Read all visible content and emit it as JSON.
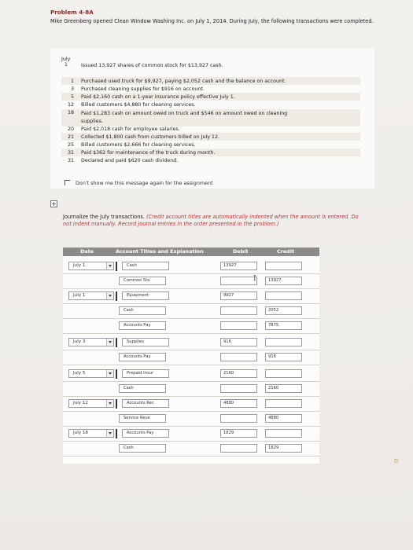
{
  "problem": {
    "title": "Problem 4-8A",
    "description": "Mike Greenberg opened Clean Window Washing Inc. on July 1, 2014. During July, the following transactions were completed."
  },
  "transactions": {
    "month_label": "July",
    "first_day": "1",
    "first_text": "Issued 13,927 shares of common stock for $13,927 cash.",
    "items": [
      {
        "day": "1",
        "text": "Purchased used truck for $9,927, paying $2,052 cash and the balance on account."
      },
      {
        "day": "3",
        "text": "Purchased cleaning supplies for $916 on account."
      },
      {
        "day": "5",
        "text": "Paid $2,160 cash on a 1-year insurance policy effective July 1."
      },
      {
        "day": "12",
        "text": "Billed customers $4,880 for cleaning services."
      },
      {
        "day": "18",
        "text": "Paid $1,283 cash on amount owed on truck and $546 on amount owed on cleaning"
      },
      {
        "day": "",
        "text": "supplies."
      },
      {
        "day": "20",
        "text": "Paid $2,018 cash for employee salaries."
      },
      {
        "day": "21",
        "text": "Collected $1,800 cash from customers billed on July 12."
      },
      {
        "day": "25",
        "text": "Billed customers $2,666 for cleaning services."
      },
      {
        "day": "31",
        "text": "Paid $362 for maintenance of the truck during month."
      },
      {
        "day": "31",
        "text": "Declared and paid $620 cash dividend."
      }
    ]
  },
  "dont_show": "Don't show me this message again for the assignment",
  "expand_symbol": "+",
  "instructions": {
    "lead": "Journalize the July transactions.",
    "note": "(Credit account titles are automatically indented when the amount is entered. Do not indent manually. Record journal entries in the order presented in the problem.)"
  },
  "table": {
    "headers": {
      "date": "Date",
      "account": "Account Titles and Explanation",
      "debit": "Debit",
      "credit": "Credit"
    },
    "entries": [
      {
        "date": "July 1",
        "lines": [
          {
            "account": "Cash",
            "debit": "13927",
            "credit": ""
          },
          {
            "account": "Common Sto",
            "debit": "",
            "credit": "13927"
          }
        ]
      },
      {
        "date": "July 1",
        "lines": [
          {
            "account": "Equipment",
            "debit": "9927",
            "credit": ""
          },
          {
            "account": "Cash",
            "debit": "",
            "credit": "2052"
          },
          {
            "account": "Accounts Pay",
            "debit": "",
            "credit": "7875"
          }
        ]
      },
      {
        "date": "July 3",
        "lines": [
          {
            "account": "Supplies",
            "debit": "916",
            "credit": ""
          },
          {
            "account": "Accounts Pay",
            "debit": "",
            "credit": "916"
          }
        ]
      },
      {
        "date": "July 5",
        "lines": [
          {
            "account": "Prepaid Insur",
            "debit": "2160",
            "credit": ""
          },
          {
            "account": "Cash",
            "debit": "",
            "credit": "2160"
          }
        ]
      },
      {
        "date": "July 12",
        "lines": [
          {
            "account": "Accounts Rec",
            "debit": "4880",
            "credit": ""
          },
          {
            "account": "Service Reve",
            "debit": "",
            "credit": "4880"
          }
        ]
      },
      {
        "date": "July 18",
        "lines": [
          {
            "account": "Accounts Pay",
            "debit": "1829",
            "credit": ""
          },
          {
            "account": "Cash",
            "debit": "",
            "credit": "1829"
          }
        ]
      }
    ]
  },
  "cursor_glyph": "I",
  "colors": {
    "title_red": "#8a2a2a",
    "note_red": "#b33a3a",
    "header_gray": "#8b8b8b"
  }
}
